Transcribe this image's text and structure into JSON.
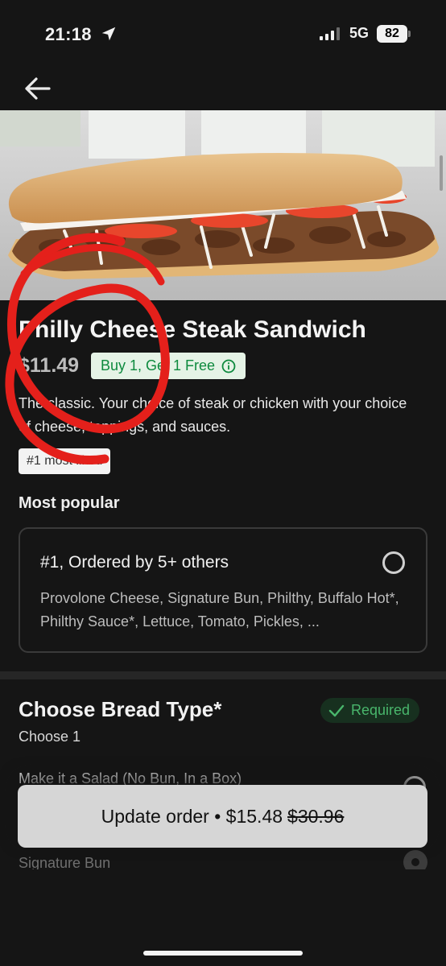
{
  "status_bar": {
    "time": "21:18",
    "network": "5G",
    "battery": "82"
  },
  "item": {
    "title": "Philly Cheese Steak Sandwich",
    "price": "$11.49",
    "promo": "Buy 1, Get 1 Free",
    "description": "The classic. Your choice of steak or chicken with your choice of cheese, toppings, and sauces.",
    "tag": "#1 most liked"
  },
  "popular": {
    "section_label": "Most popular",
    "card_title": "#1, Ordered by 5+ others",
    "card_desc": "Provolone Cheese, Signature Bun, Philthy, Buffalo Hot*, Philthy Sauce*, Lettuce, Tomato, Pickles, ..."
  },
  "bread": {
    "title": "Choose Bread Type*",
    "required_label": "Required",
    "subtitle": "Choose 1",
    "options": [
      "Make it a Salad (No Bun, In a Box)",
      "Signature Bun"
    ]
  },
  "cta": {
    "label": "Update order • $15.48",
    "original_price": "$30.96"
  },
  "colors": {
    "background": "#151515",
    "promo_green": "#0e8a3e",
    "required_green": "#49b66c",
    "annotation_red": "#e4201b"
  },
  "icons": [
    "location-arrow-icon",
    "signal-icon",
    "back-arrow-icon",
    "info-icon",
    "check-icon"
  ]
}
